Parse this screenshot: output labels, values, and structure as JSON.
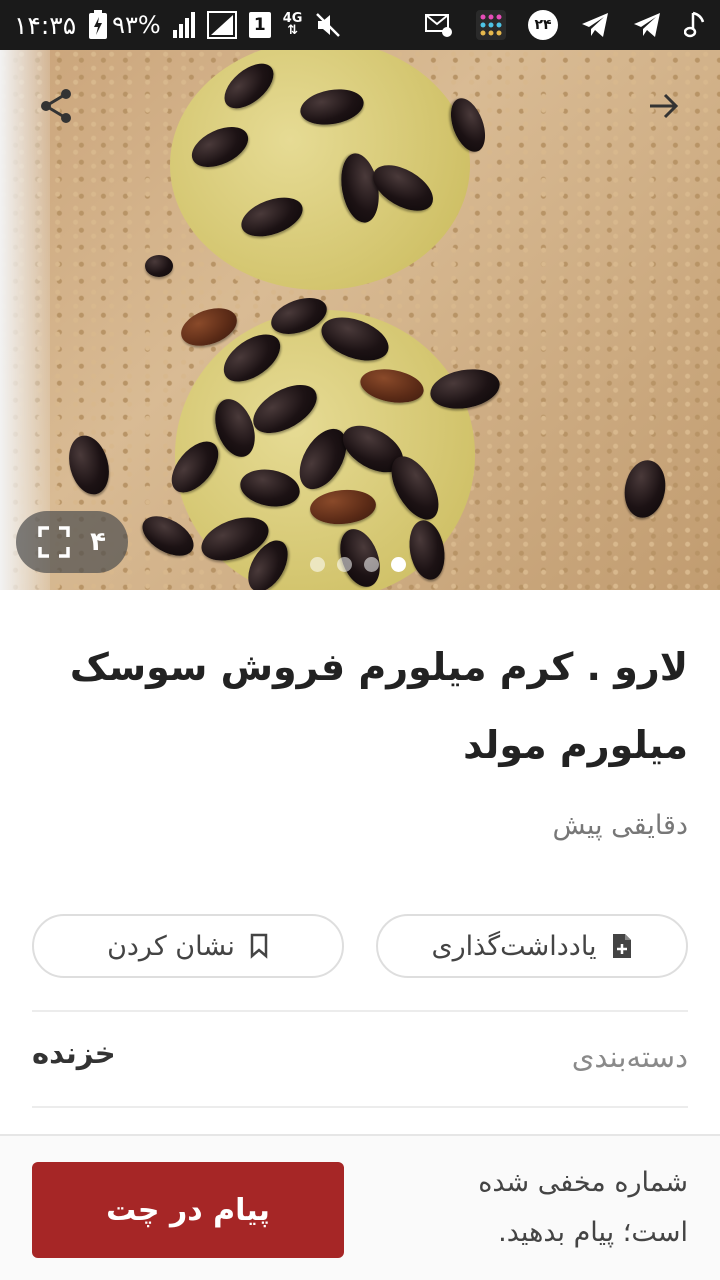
{
  "status_bar": {
    "time": "۱۴:۳۵",
    "battery": "۹۳%",
    "sim": "1",
    "network": "4G",
    "notification_count": "۲۴",
    "icons": [
      "charging-icon",
      "signal-icon",
      "signal-icon",
      "network-4g-icon",
      "mute-icon",
      "sync-settings-icon",
      "app-grid-icon",
      "telegram-icon",
      "telegram-icon",
      "music-note-icon"
    ]
  },
  "gallery": {
    "image_count": "۴",
    "dot_count": 4,
    "active_dot": 3,
    "icons": {
      "share": "share-icon",
      "back": "arrow-right-icon",
      "fullscreen": "fullscreen-icon"
    }
  },
  "listing": {
    "title": "لارو . کرم میلورم  فروش سوسک میلورم مولد",
    "posted": "دقایقی پیش"
  },
  "actions": {
    "note_label": "یادداشت‌گذاری",
    "bookmark_label": "نشان کردن"
  },
  "details": {
    "category_label": "دسته‌بندی",
    "category_value": "خزنده"
  },
  "contact": {
    "hidden_number_note": "شماره مخفی شده است؛ پیام بدهید.",
    "chat_button": "پیام در چت"
  },
  "colors": {
    "primary": "#a62626",
    "status_bar": "#1a1a1a"
  }
}
